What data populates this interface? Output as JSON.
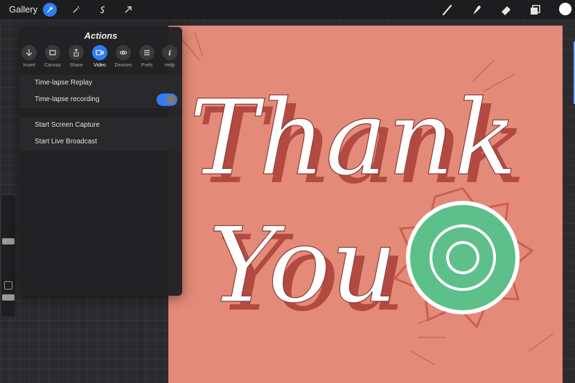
{
  "topbar": {
    "gallery_label": "Gallery",
    "left_tools": [
      "wrench-icon",
      "magic-wand-icon",
      "selection-icon",
      "transform-arrow-icon"
    ],
    "right_tools": [
      "brush-icon",
      "smudge-icon",
      "eraser-icon",
      "layers-icon"
    ],
    "current_color": "#ffffff"
  },
  "actions_panel": {
    "title": "Actions",
    "tabs": [
      {
        "label": "Insert",
        "icon": "download-arrow-icon"
      },
      {
        "label": "Canvas",
        "icon": "canvas-icon"
      },
      {
        "label": "Share",
        "icon": "share-icon"
      },
      {
        "label": "Video",
        "icon": "video-camera-icon",
        "active": true
      },
      {
        "label": "Devices",
        "icon": "devices-icon"
      },
      {
        "label": "Prefs",
        "icon": "prefs-icon"
      },
      {
        "label": "Help",
        "icon": "info-icon"
      }
    ],
    "rows": {
      "timelapse_replay": "Time-lapse Replay",
      "timelapse_recording": "Time-lapse recording",
      "timelapse_recording_on": true,
      "screen_capture": "Start Screen Capture",
      "live_broadcast": "Start Live Broadcast"
    }
  },
  "sidebar": {
    "brush_size_level": 0.45,
    "opacity_level": 0.9
  },
  "colors": {
    "accent": "#2f7cf6",
    "canvas_bg": "#e48a78",
    "lettering_fill": "#ffffff",
    "lettering_shadow": "#b24a42",
    "flower": "#5dbf8a"
  }
}
